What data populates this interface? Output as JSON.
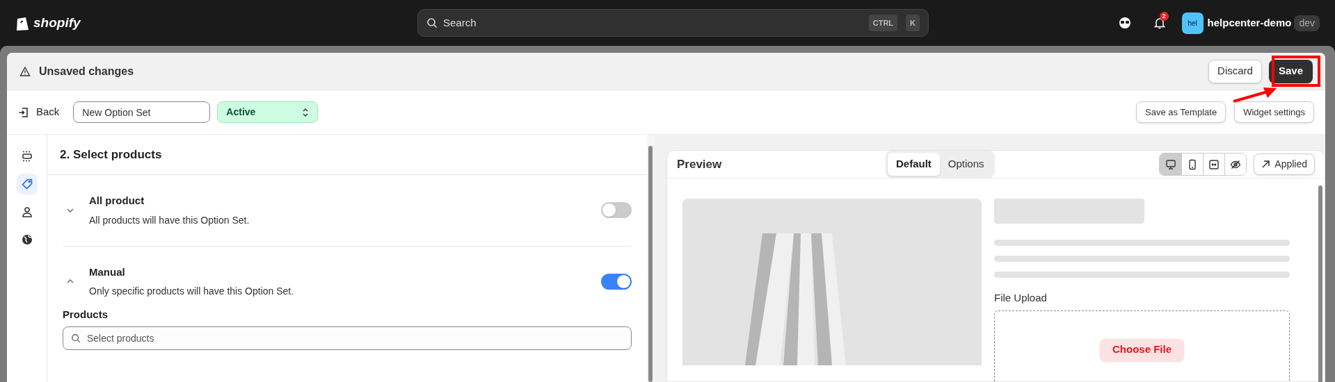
{
  "top_bar": {
    "logo": "shopify",
    "search": {
      "placeholder": "Search",
      "keys": [
        "CTRL",
        "K"
      ]
    },
    "notification_count": "2",
    "avatar": "hel",
    "store": "helpcenter-demo",
    "store_badge": "dev"
  },
  "unsaved_bar": {
    "message": "Unsaved changes",
    "buttons": [
      {
        "label": "Discard",
        "kind": "secondary"
      },
      {
        "label": "Save",
        "kind": "primary"
      }
    ]
  },
  "toolbar": {
    "back": "Back",
    "name": {
      "value": "New Option Set"
    },
    "status": "Active",
    "buttons": [
      "Save as Template",
      "Widget settings"
    ]
  },
  "sidebar": {
    "items": [
      {
        "kind": "layout",
        "selected": false
      },
      {
        "kind": "tag",
        "selected": true
      },
      {
        "kind": "person",
        "selected": false
      },
      {
        "kind": "globe",
        "selected": false
      }
    ]
  },
  "section": {
    "title": "2. Select products",
    "options": [
      {
        "title": "All product",
        "description": "All products will have this Option Set.",
        "expanded": false,
        "on": false
      },
      {
        "title": "Manual",
        "description": "Only specific products will have this Option Set.",
        "expanded": true,
        "on": true
      }
    ],
    "products_label": "Products",
    "products_search": {
      "placeholder": "Select products"
    }
  },
  "preview": {
    "title": "Preview",
    "tabs": [
      {
        "label": "Default",
        "selected": true
      },
      {
        "label": "Options",
        "selected": false
      }
    ],
    "devices": [
      {
        "kind": "desktop",
        "selected": true
      },
      {
        "kind": "mobile",
        "selected": false
      },
      {
        "kind": "expand",
        "selected": false
      },
      {
        "kind": "hidden",
        "selected": false
      }
    ],
    "applied_button": "Applied",
    "file_upload_label": "File Upload",
    "choose_file_button": "Choose File"
  }
}
